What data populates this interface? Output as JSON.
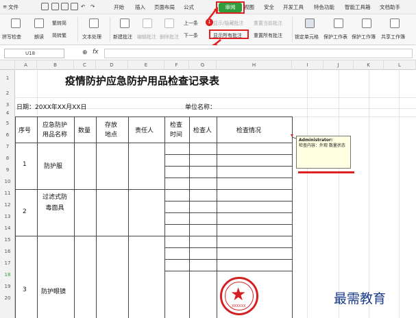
{
  "menubar": {
    "file": "文件",
    "tabs": [
      "开始",
      "插入",
      "页面布局",
      "公式",
      "审阅",
      "视图",
      "安全",
      "开发工具",
      "特色功能",
      "智能工具箱",
      "文档助手"
    ],
    "active_tab": "审阅"
  },
  "toolbar": {
    "spellcheck": "拼写检查",
    "read": "朗读",
    "t2s": "繁转简",
    "s2t": "简转繁",
    "text_proc": "文本处理",
    "new_comment": "新建批注",
    "edit_comment": "编辑批注",
    "delete_comment": "删除批注",
    "prev": "上一条",
    "next": "下一条",
    "show_hide": "显示/隐藏批注",
    "show_all": "显示所有批注",
    "reset_current": "重置当前批注",
    "reset_all": "重置所有批注",
    "lock_cell": "锁定单元格",
    "protect_sheet": "保护工作表",
    "protect_book": "保护工作簿",
    "share_book": "共享工作簿"
  },
  "formula": {
    "cell_ref": "U18",
    "fx": "fx"
  },
  "columns": [
    "A",
    "B",
    "C",
    "D",
    "E",
    "F",
    "G",
    "H",
    "I",
    "J",
    "K",
    "L"
  ],
  "rows": [
    "1",
    "2",
    "3",
    "4",
    "5",
    "6",
    "7",
    "8",
    "9",
    "10",
    "11",
    "12",
    "13",
    "14",
    "15",
    "16",
    "17",
    "18",
    "19",
    "20"
  ],
  "sheet": {
    "title": "疫情防护应急防护用品检查记录表",
    "date_label": "日期：20XX年XX月XX日",
    "unit_label": "单位名称：",
    "headers": {
      "no": "序号",
      "name": "应急防护用品名称",
      "qty": "数量",
      "location": "存放地点",
      "owner": "责任人",
      "time": "检查时间",
      "inspector": "检查人",
      "status": "检查情况"
    },
    "items": [
      {
        "no": "1",
        "name": "防护服"
      },
      {
        "no": "2",
        "name": "过滤式防毒面具"
      },
      {
        "no": "3",
        "name": "防护眼镜"
      }
    ]
  },
  "comment": {
    "author": "Administrator:",
    "text": "检查内容：外观 数量状态"
  },
  "steps": [
    "1",
    "2"
  ],
  "stamp": {
    "text": "XXXXXX"
  },
  "watermark": "最需教育",
  "colors": {
    "accent": "#2e9e3c",
    "highlight": "#e02020"
  }
}
